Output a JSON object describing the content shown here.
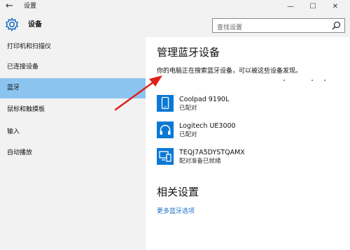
{
  "window": {
    "title": "设置",
    "back_glyph": "←",
    "minimize_glyph": "—",
    "maximize_glyph": "☐",
    "close_glyph": "✕"
  },
  "header": {
    "title": "设备",
    "search_placeholder": "查找设置"
  },
  "sidebar": {
    "items": [
      {
        "label": "打印机和扫描仪",
        "active": false
      },
      {
        "label": "已连接设备",
        "active": false
      },
      {
        "label": "蓝牙",
        "active": true
      },
      {
        "label": "鼠标和触摸板",
        "active": false
      },
      {
        "label": "输入",
        "active": false
      },
      {
        "label": "自动播放",
        "active": false
      }
    ]
  },
  "main": {
    "title": "管理蓝牙设备",
    "status": "你的电脑正在搜索蓝牙设备，可以被这些设备发现。",
    "devices": [
      {
        "name": "Coolpad 9190L",
        "status": "已配对",
        "icon": "phone-icon"
      },
      {
        "name": "Logitech UE3000",
        "status": "已配对",
        "icon": "headphones-icon"
      },
      {
        "name": "TEQJ7A5DYSTQAMX",
        "status": "配对准备已就绪",
        "icon": "computer-icon"
      }
    ],
    "related_title": "相关设置",
    "more_link": "更多蓝牙选项"
  },
  "colors": {
    "accent": "#0a78d4",
    "selected_nav": "#8cc4f0",
    "sidebar_bg": "#f2f2f2",
    "link": "#1a6fc4",
    "annotation_arrow": "#e0201c"
  }
}
